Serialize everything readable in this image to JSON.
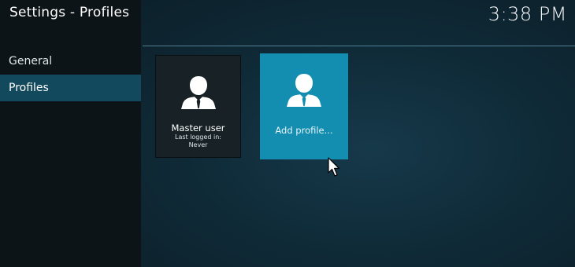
{
  "header": {
    "title": "Settings - Profiles",
    "clock": "3:38 PM"
  },
  "sidebar": {
    "items": [
      {
        "label": "General",
        "active": false
      },
      {
        "label": "Profiles",
        "active": true
      }
    ]
  },
  "profiles": {
    "master": {
      "name": "Master user",
      "last_logged_label": "Last logged in:",
      "last_logged_value": "Never"
    },
    "add": {
      "label": "Add profile..."
    }
  },
  "colors": {
    "accent": "#138db0",
    "sidebar_active": "#12495d",
    "sidebar_bg": "#0d1418"
  },
  "icons": {
    "profile": "user-silhouette-icon",
    "pointer": "mouse-cursor-icon"
  }
}
